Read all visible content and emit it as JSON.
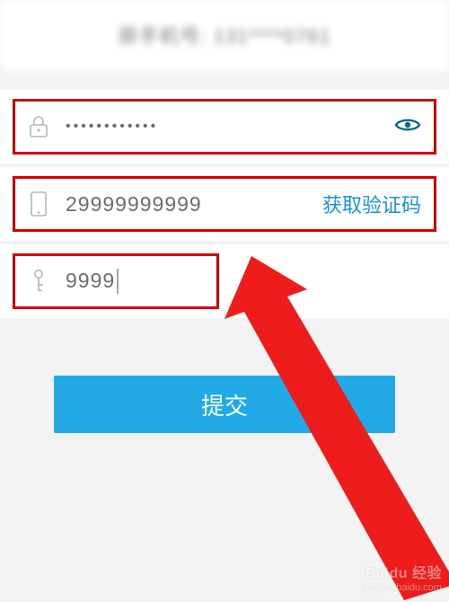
{
  "header": {
    "title": "原手机号: 131****0761"
  },
  "fields": {
    "password": {
      "value": "••••••••••••"
    },
    "phone": {
      "value": "29999999999",
      "action_label": "获取验证码"
    },
    "code": {
      "value": "9999"
    }
  },
  "submit": {
    "label": "提交"
  },
  "watermark": {
    "brand": "Baidu 经验",
    "sub": "jingyan.baidu.com"
  },
  "colors": {
    "highlight": "#d90000",
    "accent": "#1296db",
    "button": "#22aae6"
  }
}
